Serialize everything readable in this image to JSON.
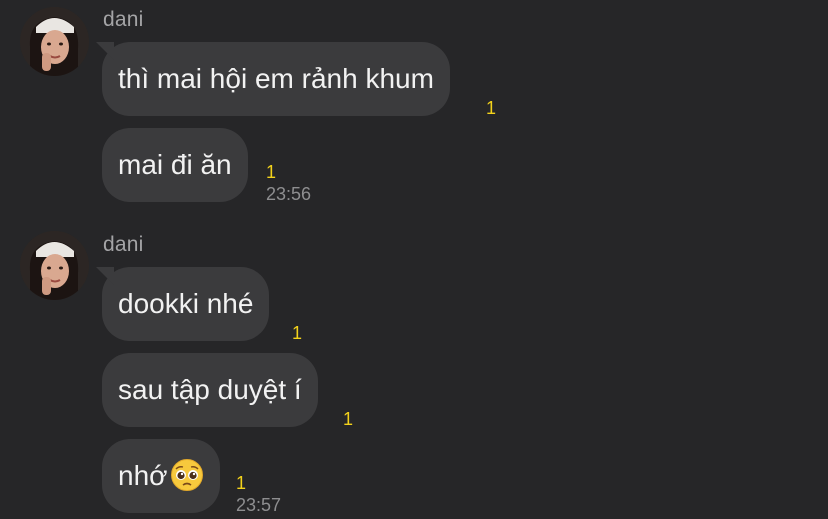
{
  "groups": [
    {
      "sender": "dani",
      "messages": [
        {
          "text": "thì mai hội em rảnh khum",
          "unread": "1",
          "time": ""
        },
        {
          "text": "mai đi ăn",
          "unread": "1",
          "time": "23:56"
        }
      ]
    },
    {
      "sender": "dani",
      "messages": [
        {
          "text": "dookki nhé",
          "unread": "1",
          "time": ""
        },
        {
          "text": "sau tập duyệt í",
          "unread": "1",
          "time": ""
        },
        {
          "text": "nhớ",
          "emoji": "pleading-face-emoji",
          "unread": "1",
          "time": "23:57"
        }
      ]
    }
  ],
  "colors": {
    "background": "#262628",
    "bubble": "#3b3b3d",
    "text": "#f2f2f2",
    "sender": "#a4a4a6",
    "unread": "#f3d21b",
    "time": "#8e8e90"
  }
}
